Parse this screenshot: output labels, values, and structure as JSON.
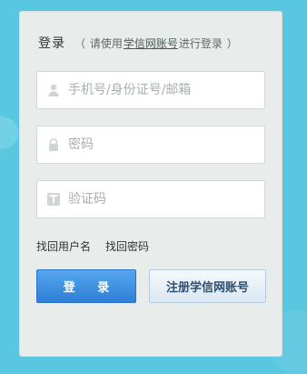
{
  "colors": {
    "background": "#59c7df",
    "panel": "#e8eceb",
    "login_button": "#2e7fd6",
    "register_button": "#dbe7f3"
  },
  "header": {
    "title": "登录",
    "hint": {
      "open_paren": "（",
      "prefix": "请使用",
      "link": "学信网账号",
      "suffix": "进行登录",
      "close_paren": "）"
    }
  },
  "form": {
    "username": {
      "placeholder": "手机号/身份证号/邮箱",
      "icon": "user-icon"
    },
    "password": {
      "placeholder": "密码",
      "icon": "lock-icon"
    },
    "captcha": {
      "placeholder": "验证码",
      "icon": "captcha-icon"
    }
  },
  "links": {
    "recover_username": "找回用户名",
    "recover_password": "找回密码"
  },
  "buttons": {
    "login": "登 录",
    "register": "注册学信网账号"
  }
}
